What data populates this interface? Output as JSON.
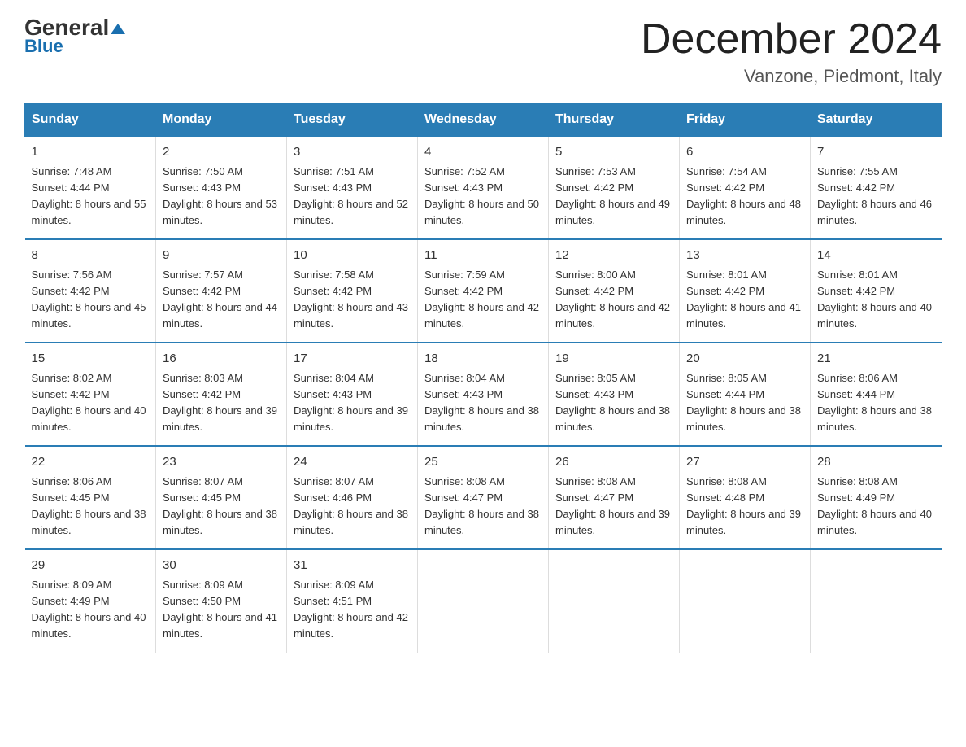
{
  "logo": {
    "part1": "General",
    "part2": "Blue"
  },
  "title": {
    "month_year": "December 2024",
    "location": "Vanzone, Piedmont, Italy"
  },
  "days_of_week": [
    "Sunday",
    "Monday",
    "Tuesday",
    "Wednesday",
    "Thursday",
    "Friday",
    "Saturday"
  ],
  "weeks": [
    [
      {
        "day": "1",
        "sunrise": "7:48 AM",
        "sunset": "4:44 PM",
        "daylight": "8 hours and 55 minutes."
      },
      {
        "day": "2",
        "sunrise": "7:50 AM",
        "sunset": "4:43 PM",
        "daylight": "8 hours and 53 minutes."
      },
      {
        "day": "3",
        "sunrise": "7:51 AM",
        "sunset": "4:43 PM",
        "daylight": "8 hours and 52 minutes."
      },
      {
        "day": "4",
        "sunrise": "7:52 AM",
        "sunset": "4:43 PM",
        "daylight": "8 hours and 50 minutes."
      },
      {
        "day": "5",
        "sunrise": "7:53 AM",
        "sunset": "4:42 PM",
        "daylight": "8 hours and 49 minutes."
      },
      {
        "day": "6",
        "sunrise": "7:54 AM",
        "sunset": "4:42 PM",
        "daylight": "8 hours and 48 minutes."
      },
      {
        "day": "7",
        "sunrise": "7:55 AM",
        "sunset": "4:42 PM",
        "daylight": "8 hours and 46 minutes."
      }
    ],
    [
      {
        "day": "8",
        "sunrise": "7:56 AM",
        "sunset": "4:42 PM",
        "daylight": "8 hours and 45 minutes."
      },
      {
        "day": "9",
        "sunrise": "7:57 AM",
        "sunset": "4:42 PM",
        "daylight": "8 hours and 44 minutes."
      },
      {
        "day": "10",
        "sunrise": "7:58 AM",
        "sunset": "4:42 PM",
        "daylight": "8 hours and 43 minutes."
      },
      {
        "day": "11",
        "sunrise": "7:59 AM",
        "sunset": "4:42 PM",
        "daylight": "8 hours and 42 minutes."
      },
      {
        "day": "12",
        "sunrise": "8:00 AM",
        "sunset": "4:42 PM",
        "daylight": "8 hours and 42 minutes."
      },
      {
        "day": "13",
        "sunrise": "8:01 AM",
        "sunset": "4:42 PM",
        "daylight": "8 hours and 41 minutes."
      },
      {
        "day": "14",
        "sunrise": "8:01 AM",
        "sunset": "4:42 PM",
        "daylight": "8 hours and 40 minutes."
      }
    ],
    [
      {
        "day": "15",
        "sunrise": "8:02 AM",
        "sunset": "4:42 PM",
        "daylight": "8 hours and 40 minutes."
      },
      {
        "day": "16",
        "sunrise": "8:03 AM",
        "sunset": "4:42 PM",
        "daylight": "8 hours and 39 minutes."
      },
      {
        "day": "17",
        "sunrise": "8:04 AM",
        "sunset": "4:43 PM",
        "daylight": "8 hours and 39 minutes."
      },
      {
        "day": "18",
        "sunrise": "8:04 AM",
        "sunset": "4:43 PM",
        "daylight": "8 hours and 38 minutes."
      },
      {
        "day": "19",
        "sunrise": "8:05 AM",
        "sunset": "4:43 PM",
        "daylight": "8 hours and 38 minutes."
      },
      {
        "day": "20",
        "sunrise": "8:05 AM",
        "sunset": "4:44 PM",
        "daylight": "8 hours and 38 minutes."
      },
      {
        "day": "21",
        "sunrise": "8:06 AM",
        "sunset": "4:44 PM",
        "daylight": "8 hours and 38 minutes."
      }
    ],
    [
      {
        "day": "22",
        "sunrise": "8:06 AM",
        "sunset": "4:45 PM",
        "daylight": "8 hours and 38 minutes."
      },
      {
        "day": "23",
        "sunrise": "8:07 AM",
        "sunset": "4:45 PM",
        "daylight": "8 hours and 38 minutes."
      },
      {
        "day": "24",
        "sunrise": "8:07 AM",
        "sunset": "4:46 PM",
        "daylight": "8 hours and 38 minutes."
      },
      {
        "day": "25",
        "sunrise": "8:08 AM",
        "sunset": "4:47 PM",
        "daylight": "8 hours and 38 minutes."
      },
      {
        "day": "26",
        "sunrise": "8:08 AM",
        "sunset": "4:47 PM",
        "daylight": "8 hours and 39 minutes."
      },
      {
        "day": "27",
        "sunrise": "8:08 AM",
        "sunset": "4:48 PM",
        "daylight": "8 hours and 39 minutes."
      },
      {
        "day": "28",
        "sunrise": "8:08 AM",
        "sunset": "4:49 PM",
        "daylight": "8 hours and 40 minutes."
      }
    ],
    [
      {
        "day": "29",
        "sunrise": "8:09 AM",
        "sunset": "4:49 PM",
        "daylight": "8 hours and 40 minutes."
      },
      {
        "day": "30",
        "sunrise": "8:09 AM",
        "sunset": "4:50 PM",
        "daylight": "8 hours and 41 minutes."
      },
      {
        "day": "31",
        "sunrise": "8:09 AM",
        "sunset": "4:51 PM",
        "daylight": "8 hours and 42 minutes."
      },
      null,
      null,
      null,
      null
    ]
  ]
}
